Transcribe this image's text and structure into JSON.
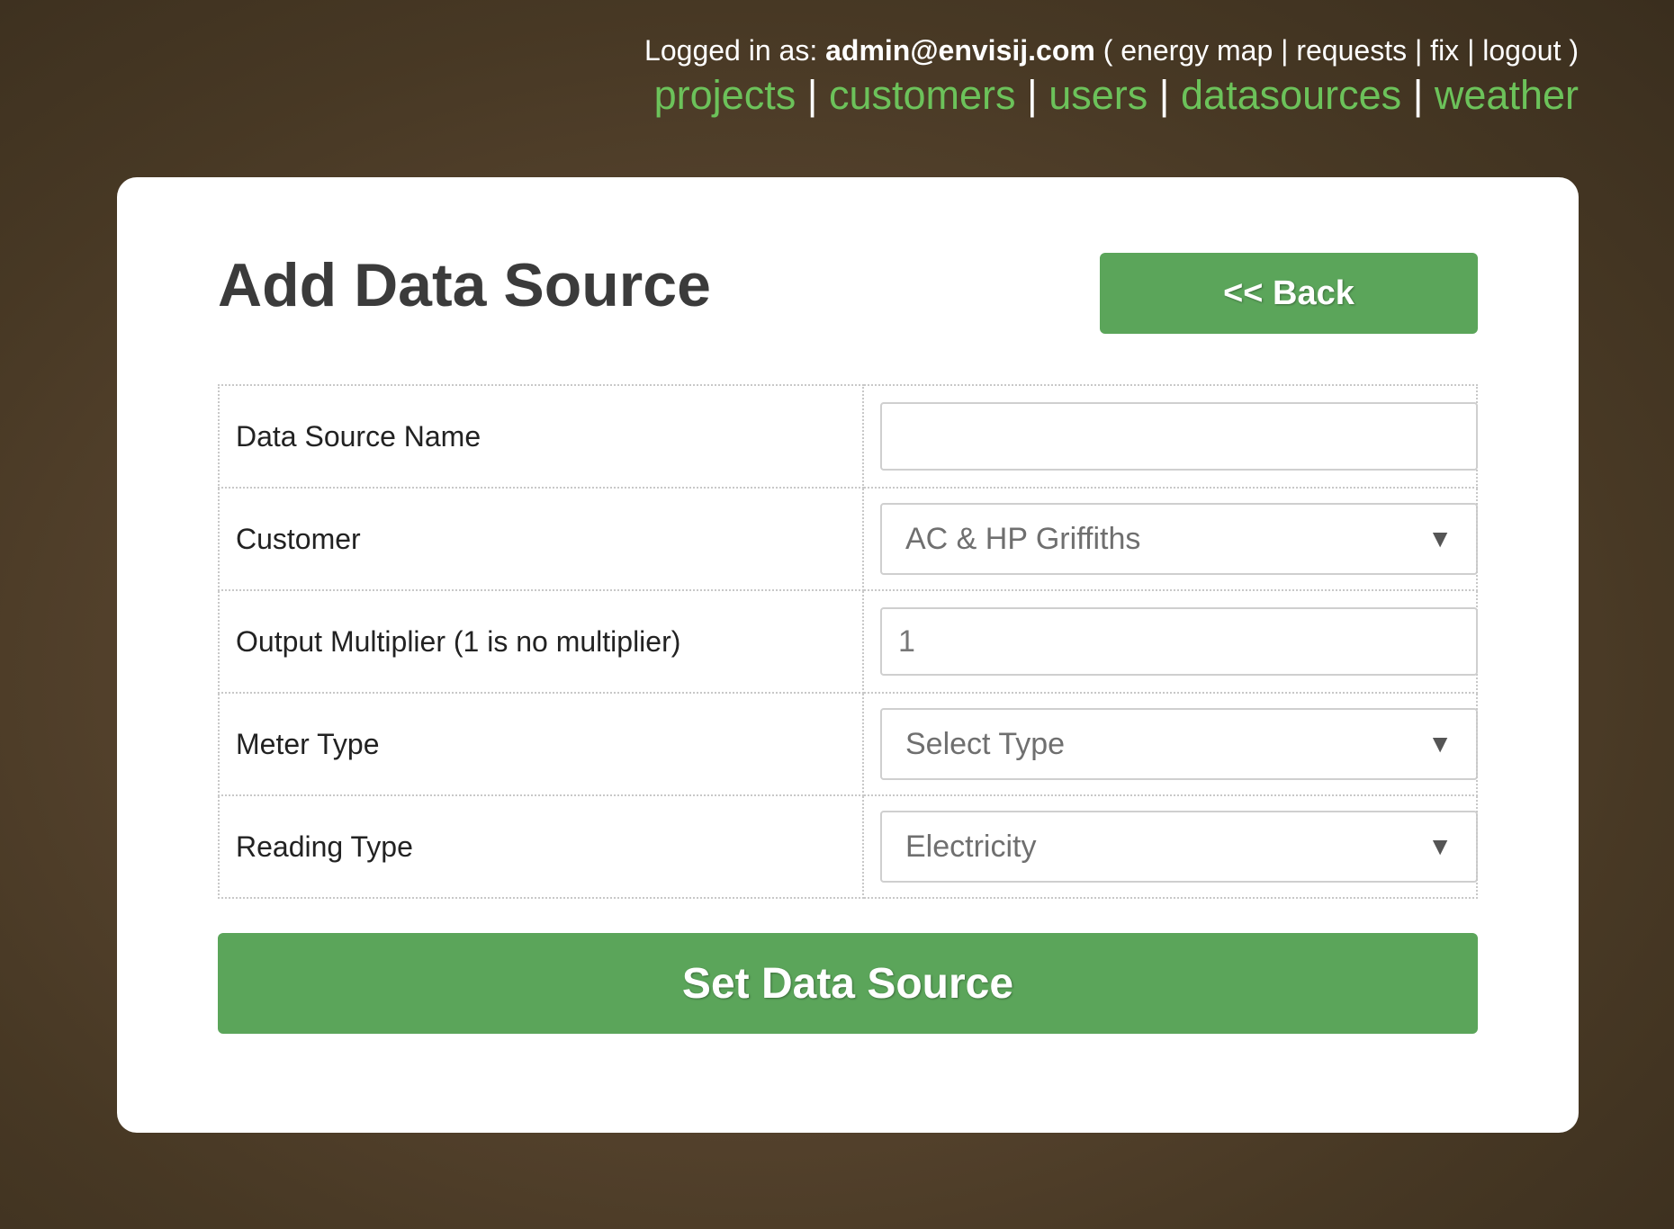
{
  "header": {
    "logged_in_prefix": "Logged in as:",
    "user_email": "admin@envisij.com",
    "open_paren": "(",
    "close_paren": ")",
    "separator": "|",
    "account_links": [
      "energy map",
      "requests",
      "fix",
      "logout"
    ],
    "nav_links": [
      "projects",
      "customers",
      "users",
      "datasources",
      "weather"
    ]
  },
  "panel": {
    "title": "Add Data Source",
    "back_label": "<< Back"
  },
  "form": {
    "fields": [
      {
        "label": "Data Source Name",
        "value": ""
      },
      {
        "label": "Customer",
        "selected": "AC & HP Griffiths"
      },
      {
        "label": "Output Multiplier (1 is no multiplier)",
        "value": "1"
      },
      {
        "label": "Meter Type",
        "selected": "Select Type"
      },
      {
        "label": "Reading Type",
        "selected": "Electricity"
      }
    ],
    "submit_label": "Set Data Source"
  },
  "icons": {
    "dropdown": "triangle-down-icon"
  },
  "colors": {
    "accent_green": "#5ba55a",
    "nav_link_green": "#6cc25a",
    "panel_background": "#ffffff",
    "page_background": "#4f3e28"
  }
}
